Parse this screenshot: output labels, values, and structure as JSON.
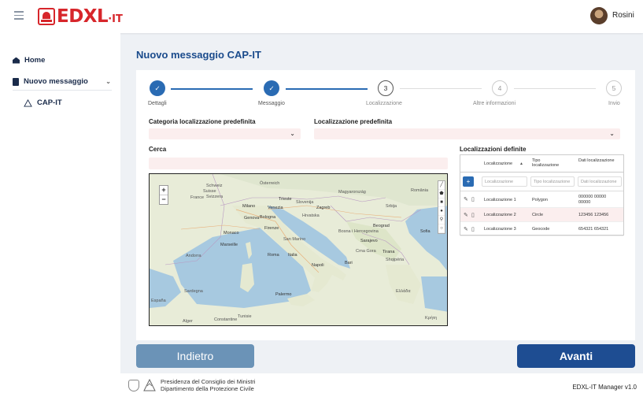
{
  "header": {
    "brand": "EDXL",
    "brand_suffix": "·IT",
    "username": "Rosini"
  },
  "sidebar": {
    "items": [
      {
        "label": "Home"
      },
      {
        "label": "Nuovo messaggio"
      },
      {
        "label": "CAP-IT"
      }
    ]
  },
  "page": {
    "title": "Nuovo messaggio CAP-IT"
  },
  "stepper": {
    "steps": [
      {
        "number": "✓",
        "label": "Dettagli",
        "state": "done"
      },
      {
        "number": "✓",
        "label": "Messaggio",
        "state": "done"
      },
      {
        "number": "3",
        "label": "Localizzazione",
        "state": "current"
      },
      {
        "number": "4",
        "label": "Altre informazioni",
        "state": "todo"
      },
      {
        "number": "5",
        "label": "Invio",
        "state": "todo"
      }
    ]
  },
  "form": {
    "category_label": "Categoria localizzazione predefinita",
    "category_value": "",
    "predefined_label": "Localizzazione predefinita",
    "predefined_value": "",
    "search_label": "Cerca",
    "search_value": ""
  },
  "map": {
    "zoom_in": "+",
    "zoom_out": "−",
    "labels": [
      "Schweiz",
      "Suisse",
      "Svizzera",
      "Österreich",
      "Magyarország",
      "France",
      "Slovenija",
      "Hrvatska",
      "Bosna i Hercegovina",
      "Srbija",
      "România",
      "Monaco",
      "Milano",
      "Venezia",
      "Genova",
      "Bologna",
      "Marseille",
      "Firenze",
      "Andorra",
      "Roma",
      "Italia",
      "Napoli",
      "Bari",
      "Tirana",
      "Shqipëria",
      "Ελλάδα",
      "Palermo",
      "Tunisie",
      "Alger",
      "Constantine",
      "Sardegna",
      "España",
      "Beograd",
      "Sarajevo",
      "San Marino",
      "Zagreb",
      "Crna Gora",
      "Trieste",
      "Sofia",
      "Κρήτη"
    ]
  },
  "table": {
    "title": "Localizzazioni definite",
    "columns": [
      "Localizzazione",
      "Tipo localizzazione",
      "Dati localizzazione"
    ],
    "sort_indicator": "▲",
    "filters": [
      "Localizzazione",
      "Tipo localizzazione",
      "Dati localizzazione"
    ],
    "add_label": "+",
    "rows": [
      {
        "name": "Localizzazione 1",
        "type": "Polygon",
        "data": "000000 00000 00000"
      },
      {
        "name": "Localizzazione 2",
        "type": "Circle",
        "data": "123456 123456"
      },
      {
        "name": "Localizzazione 3",
        "type": "Geocode",
        "data": "654321 654321"
      }
    ]
  },
  "actions": {
    "back": "Indietro",
    "next": "Avanti"
  },
  "footer": {
    "org_line1": "Presidenza del Consiglio dei Ministri",
    "org_line2": "Dipartimento della Protezione Civile",
    "version": "EDXL-IT Manager v1.0"
  },
  "colors": {
    "brand_red": "#d7262b",
    "primary_blue": "#1e4d92",
    "step_blue": "#2a6bb3",
    "back_button": "#6b93b7",
    "input_tint": "#fbeeee"
  }
}
